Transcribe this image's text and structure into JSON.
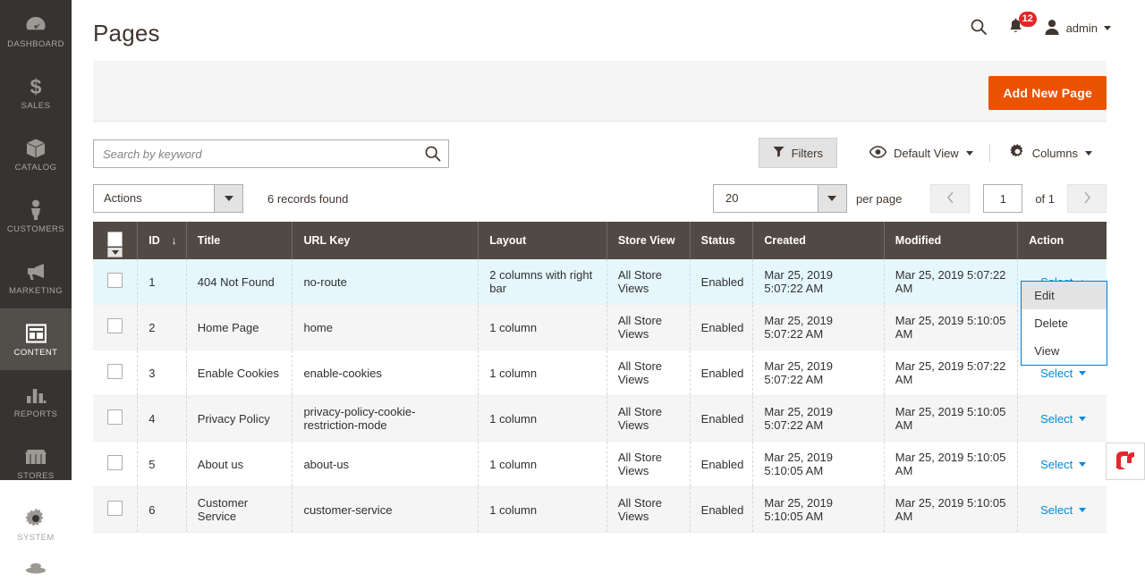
{
  "sidebar": {
    "items": [
      {
        "label": "DASHBOARD",
        "icon": "dashboard-icon",
        "active": false
      },
      {
        "label": "SALES",
        "icon": "dollar-icon",
        "active": false
      },
      {
        "label": "CATALOG",
        "icon": "box-icon",
        "active": false
      },
      {
        "label": "CUSTOMERS",
        "icon": "person-icon",
        "active": false
      },
      {
        "label": "MARKETING",
        "icon": "megaphone-icon",
        "active": false
      },
      {
        "label": "CONTENT",
        "icon": "layout-icon",
        "active": true
      },
      {
        "label": "REPORTS",
        "icon": "bar-chart-icon",
        "active": false
      },
      {
        "label": "STORES",
        "icon": "storefront-icon",
        "active": false
      },
      {
        "label": "SYSTEM",
        "icon": "gear-icon",
        "active": false
      }
    ]
  },
  "header": {
    "title": "Pages",
    "search_icon": "search-icon",
    "notifications_icon": "bell-icon",
    "notifications_count": "12",
    "user_icon": "user-avatar-icon",
    "user_name": "admin"
  },
  "action_panel": {
    "add_new_page_label": "Add New Page",
    "add_new_page_color": "#eb5202"
  },
  "toolbar": {
    "search_placeholder": "Search by keyword",
    "search_value": "",
    "search_icon": "search-icon",
    "filters_label": "Filters",
    "filters_icon": "funnel-icon",
    "view_label": "Default View",
    "view_icon": "eye-icon",
    "columns_label": "Columns",
    "columns_icon": "gear-icon",
    "actions_label": "Actions",
    "records_found": "6 records found",
    "per_page_value": "20",
    "per_page_label": "per page",
    "page_current": "1",
    "page_total": "of 1",
    "prev_icon": "chevron-left-icon",
    "next_icon": "chevron-right-icon"
  },
  "grid": {
    "columns": [
      {
        "key": "checkbox",
        "label": ""
      },
      {
        "key": "id",
        "label": "ID",
        "sorted": "asc",
        "sort_glyph": "↓"
      },
      {
        "key": "title",
        "label": "Title"
      },
      {
        "key": "url_key",
        "label": "URL Key"
      },
      {
        "key": "layout",
        "label": "Layout"
      },
      {
        "key": "store_view",
        "label": "Store View"
      },
      {
        "key": "status",
        "label": "Status"
      },
      {
        "key": "created",
        "label": "Created"
      },
      {
        "key": "modified",
        "label": "Modified"
      },
      {
        "key": "action",
        "label": "Action"
      }
    ],
    "action_link_label": "Select",
    "rows": [
      {
        "id": "1",
        "title": "404 Not Found",
        "url_key": "no-route",
        "layout": "2 columns with right bar",
        "store_view": "All Store Views",
        "status": "Enabled",
        "created": "Mar 25, 2019 5:07:22 AM",
        "modified": "Mar 25, 2019 5:07:22 AM",
        "highlighted": true,
        "menu_open": true
      },
      {
        "id": "2",
        "title": "Home Page",
        "url_key": "home",
        "layout": "1 column",
        "store_view": "All Store Views",
        "status": "Enabled",
        "created": "Mar 25, 2019 5:07:22 AM",
        "modified": "Mar 25, 2019 5:10:05 AM",
        "highlighted": false,
        "menu_open": false
      },
      {
        "id": "3",
        "title": "Enable Cookies",
        "url_key": "enable-cookies",
        "layout": "1 column",
        "store_view": "All Store Views",
        "status": "Enabled",
        "created": "Mar 25, 2019 5:07:22 AM",
        "modified": "Mar 25, 2019 5:07:22 AM",
        "highlighted": false,
        "menu_open": false
      },
      {
        "id": "4",
        "title": "Privacy Policy",
        "url_key": "privacy-policy-cookie-restriction-mode",
        "layout": "1 column",
        "store_view": "All Store Views",
        "status": "Enabled",
        "created": "Mar 25, 2019 5:07:22 AM",
        "modified": "Mar 25, 2019 5:10:05 AM",
        "highlighted": false,
        "menu_open": false
      },
      {
        "id": "5",
        "title": "About us",
        "url_key": "about-us",
        "layout": "1 column",
        "store_view": "All Store Views",
        "status": "Enabled",
        "created": "Mar 25, 2019 5:10:05 AM",
        "modified": "Mar 25, 2019 5:10:05 AM",
        "highlighted": false,
        "menu_open": false
      },
      {
        "id": "6",
        "title": "Customer Service",
        "url_key": "customer-service",
        "layout": "1 column",
        "store_view": "All Store Views",
        "status": "Enabled",
        "created": "Mar 25, 2019 5:10:05 AM",
        "modified": "Mar 25, 2019 5:10:05 AM",
        "highlighted": false,
        "menu_open": false
      }
    ]
  },
  "action_menu": {
    "items": [
      {
        "label": "Edit",
        "highlighted": true
      },
      {
        "label": "Delete",
        "highlighted": false
      },
      {
        "label": "View",
        "highlighted": false
      }
    ]
  },
  "corner_widget": {
    "icon": "brand-logo-icon",
    "color": "#e3262f"
  }
}
